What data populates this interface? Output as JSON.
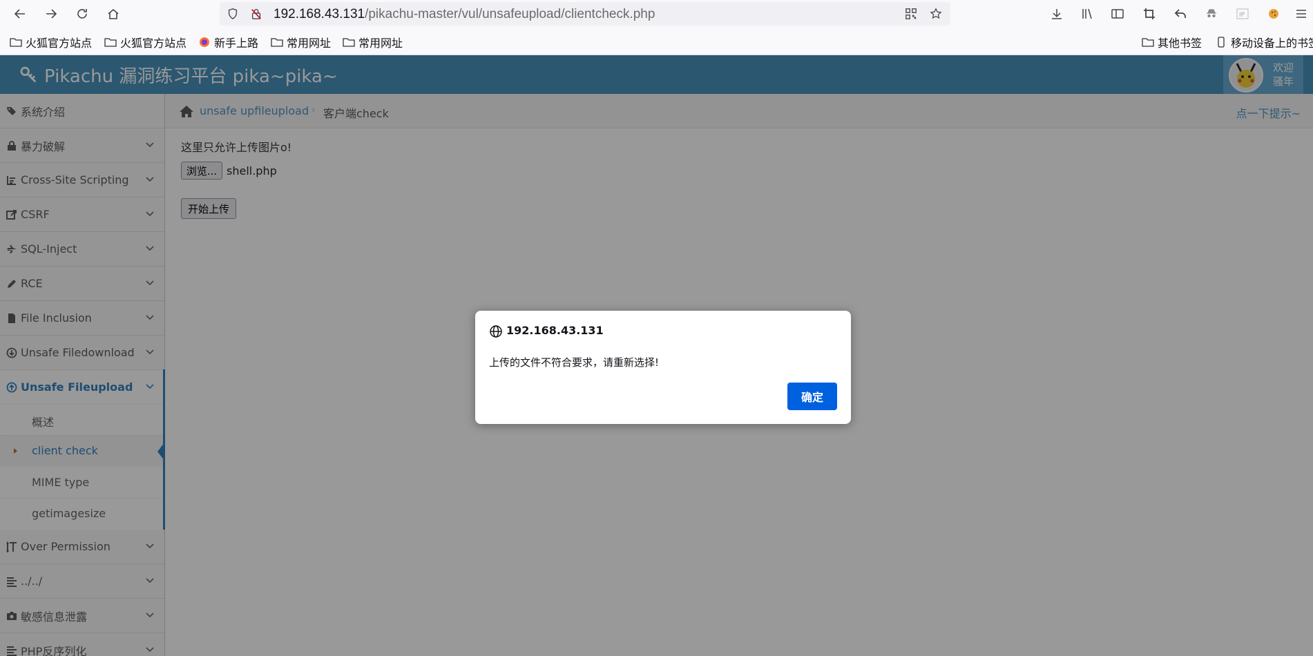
{
  "browser": {
    "url_host": "192.168.43.131",
    "url_path": "/pikachu-master/vul/unsafeupload/clientcheck.php",
    "bookmarks": [
      "火狐官方站点",
      "火狐官方站点",
      "新手上路",
      "常用网址",
      "常用网址"
    ],
    "other_bookmarks": "其他书签",
    "mobile_bookmarks": "移动设备上的书签"
  },
  "header": {
    "title": "Pikachu 漏洞练习平台 pika~pika~",
    "welcome_line1": "欢迎",
    "welcome_line2": "骚年"
  },
  "sidebar": {
    "items": [
      {
        "label": "系统介绍",
        "icon": "tags-icon"
      },
      {
        "label": "暴力破解",
        "icon": "lock-icon"
      },
      {
        "label": "Cross-Site Scripting",
        "icon": "sitemap-icon"
      },
      {
        "label": "CSRF",
        "icon": "share-icon"
      },
      {
        "label": "SQL-Inject",
        "icon": "fighter-jet-icon"
      },
      {
        "label": "RCE",
        "icon": "pencil-icon"
      },
      {
        "label": "File Inclusion",
        "icon": "file-icon"
      },
      {
        "label": "Unsafe Filedownload",
        "icon": "download-icon"
      },
      {
        "label": "Unsafe Fileupload",
        "icon": "upload-icon"
      },
      {
        "label": "Over Permission",
        "icon": "text-height-icon"
      },
      {
        "label": "../../",
        "icon": "align-left-icon"
      },
      {
        "label": "敏感信息泄露",
        "icon": "camera-icon"
      },
      {
        "label": "PHP反序列化",
        "icon": "align-left-icon"
      }
    ],
    "submenu": [
      "概述",
      "client check",
      "MIME type",
      "getimagesize"
    ]
  },
  "breadcrumbs": {
    "section": "unsafe upfileupload",
    "page": "客户端check",
    "hint": "点一下提示~"
  },
  "content": {
    "intro": "这里只允许上传图片o!",
    "browse_label": "浏览...",
    "file_name": "shell.php",
    "upload_label": "开始上传"
  },
  "dialog": {
    "title": "192.168.43.131",
    "message": "上传的文件不符合要求，请重新选择!",
    "ok_label": "确定"
  }
}
